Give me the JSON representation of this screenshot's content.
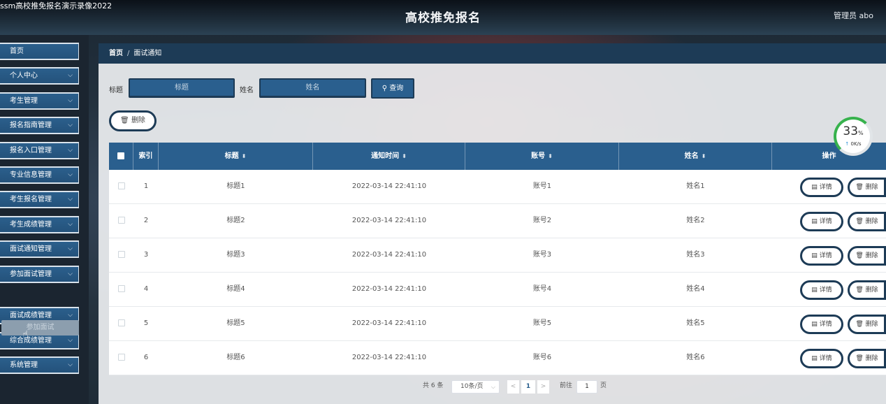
{
  "window": {
    "title": "ssm高校推免报名演示录像2022"
  },
  "header": {
    "title": "高校推免报名",
    "admin": "管理员 abo"
  },
  "sidebar": {
    "items": [
      {
        "label": "首页",
        "expandable": false
      },
      {
        "label": "个人中心",
        "expandable": true
      },
      {
        "label": "考生管理",
        "expandable": true
      },
      {
        "label": "报名指南管理",
        "expandable": true
      },
      {
        "label": "报名入口管理",
        "expandable": true
      },
      {
        "label": "专业信息管理",
        "expandable": true
      },
      {
        "label": "考生报名管理",
        "expandable": true
      },
      {
        "label": "考生成绩管理",
        "expandable": true
      },
      {
        "label": "面试通知管理",
        "expandable": true
      },
      {
        "label": "参加面试管理",
        "expandable": true
      },
      {
        "label": "面试成绩管理",
        "expandable": true
      },
      {
        "label": "综合成绩管理",
        "expandable": true
      },
      {
        "label": "系统管理",
        "expandable": true
      }
    ],
    "submenu_item": "参加面试"
  },
  "breadcrumb": {
    "home": "首页",
    "separator": "/",
    "current": "面试通知"
  },
  "search": {
    "title_label": "标题",
    "title_placeholder": "标题",
    "name_label": "姓名",
    "name_placeholder": "姓名",
    "query_label": "查询",
    "query_icon": "search-icon"
  },
  "toolbar": {
    "delete_label": "删除",
    "delete_icon": "trash-icon"
  },
  "table": {
    "columns": [
      "索引",
      "标题",
      "通知时间",
      "账号",
      "姓名",
      "操作"
    ],
    "rows": [
      {
        "index": "1",
        "title": "标题1",
        "time": "2022-03-14 22:41:10",
        "account": "账号1",
        "name": "姓名1"
      },
      {
        "index": "2",
        "title": "标题2",
        "time": "2022-03-14 22:41:10",
        "account": "账号2",
        "name": "姓名2"
      },
      {
        "index": "3",
        "title": "标题3",
        "time": "2022-03-14 22:41:10",
        "account": "账号3",
        "name": "姓名3"
      },
      {
        "index": "4",
        "title": "标题4",
        "time": "2022-03-14 22:41:10",
        "account": "账号4",
        "name": "姓名4"
      },
      {
        "index": "5",
        "title": "标题5",
        "time": "2022-03-14 22:41:10",
        "account": "账号5",
        "name": "姓名5"
      },
      {
        "index": "6",
        "title": "标题6",
        "time": "2022-03-14 22:41:10",
        "account": "账号6",
        "name": "姓名6"
      }
    ],
    "detail_label": "详情",
    "delete_label": "删除"
  },
  "pagination": {
    "total": "共 6 条",
    "page_size": "10条/页",
    "prev": "<",
    "current": "1",
    "next": ">",
    "goto_label": "前往",
    "goto_value": "1",
    "page_suffix": "页"
  },
  "network_badge": {
    "percent": "33",
    "percent_unit": "%",
    "speed": "0K/s"
  },
  "colors": {
    "primary": "#2a5f8e",
    "dark": "#1d3b56",
    "ring": "#37b24d"
  }
}
